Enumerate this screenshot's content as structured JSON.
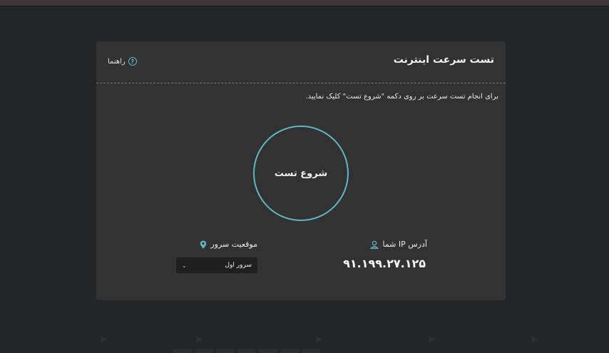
{
  "header": {
    "title": "تست سرعت اینترنت",
    "help_label": "راهنما",
    "help_icon": "question-circle-icon"
  },
  "description": "برای انجام تست سرعت بر روی دکمه \"شروع تست\" کلیک نمایید.",
  "start_button": {
    "label": "شروع تست"
  },
  "ip": {
    "label": "آدرس IP شما",
    "icon": "user-icon",
    "value": "۹۱.۱۹۹.۲۷.۱۲۵"
  },
  "server": {
    "label": "موقعیت سرور",
    "icon": "location-pin-icon",
    "selected": "سرور اول"
  },
  "colors": {
    "accent": "#5fb8c0",
    "background": "#232526",
    "card": "#323232",
    "select_bg": "#1f1f1f"
  }
}
